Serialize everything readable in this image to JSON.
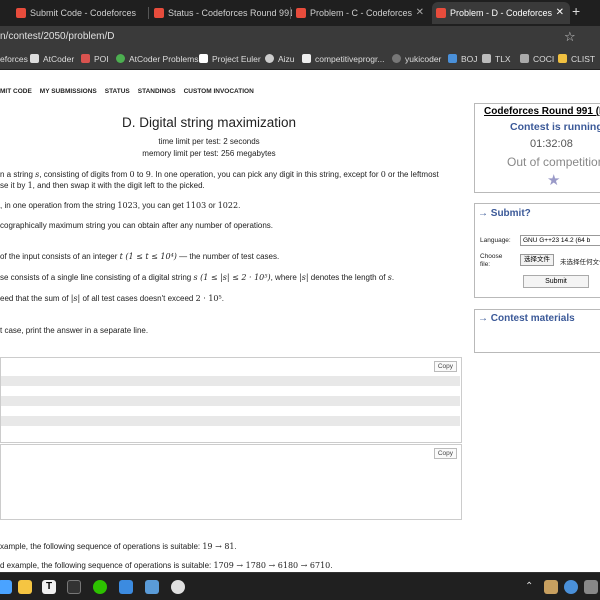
{
  "browser": {
    "tabs": [
      {
        "title": "Submit Code - Codeforces",
        "active": false
      },
      {
        "title": "Status - Codeforces Round 991",
        "active": false
      },
      {
        "title": "Problem - C - Codeforces",
        "active": false
      },
      {
        "title": "Problem - D - Codeforces",
        "active": true
      }
    ],
    "new_tab_label": "+",
    "address": "n/contest/2050/problem/D",
    "bookmarks": [
      "eforces",
      "AtCoder",
      "POI",
      "AtCoder Problems",
      "Project Euler",
      "Aizu",
      "competitiveprogr...",
      "yukicoder",
      "BOJ",
      "TLX",
      "COCI",
      "CLIST"
    ]
  },
  "nav": [
    "MIT CODE",
    "MY SUBMISSIONS",
    "STATUS",
    "STANDINGS",
    "CUSTOM INVOCATION"
  ],
  "problem": {
    "title": "D. Digital string maximization",
    "time_limit": "time limit per test: 2 seconds",
    "memory_limit": "memory limit per test: 256 megabytes",
    "statement_1a": "n a string ",
    "statement_1b": "s",
    "statement_1c": ", consisting of digits from ",
    "statement_1d": "0",
    "statement_1e": " to ",
    "statement_1f": "9",
    "statement_1g": ". In one operation, you can pick any digit in this string, except for ",
    "statement_1h": "0",
    "statement_1i": " or the leftmost",
    "statement_2a": "se it by ",
    "statement_2b": "1",
    "statement_2c": ", and then swap it with the digit left to the picked.",
    "statement_3a": ", in one operation from the string ",
    "statement_3b": "1023",
    "statement_3c": ", you can get ",
    "statement_3d": "1103",
    "statement_3e": " or ",
    "statement_3f": "1022",
    "statement_3g": ".",
    "statement_4": "cographically maximum string you can obtain after any number of operations.",
    "input_1a": " of the input consists of an integer ",
    "input_1b": "t (1 ≤ t ≤ 10⁴)",
    "input_1c": " — the number of test cases.",
    "input_2a": "se consists of a single line consisting of a digital string ",
    "input_2b": "s (1 ≤ |s| ≤ 2 · 10⁵)",
    "input_2c": ", where ",
    "input_2d": "|s|",
    "input_2e": " denotes the length of ",
    "input_2f": "s",
    "input_2g": ".",
    "input_3a": "eed that the sum of ",
    "input_3b": "|s|",
    "input_3c": " of all test cases doesn't exceed ",
    "input_3d": "2 · 10⁵",
    "input_3e": ".",
    "output_1": "t case, print the answer in a separate line.",
    "copy_label": "Copy",
    "note_1a": "xample, the following sequence of operations is suitable: ",
    "note_1b": "19 → 81",
    "note_1c": ".",
    "note_2a": "d example, the following sequence of operations is suitable: ",
    "note_2b": "1709 → 1780 → 6180 → 6710",
    "note_2c": "."
  },
  "sidebar": {
    "contest_title": "Codeforces Round 991 (D",
    "status": "Contest is running",
    "timer": "01:32:08",
    "participation": "Out of competition",
    "submit_header": "→ Submit?",
    "language_label": "Language:",
    "language_value": "GNU G++23 14.2 (64 b",
    "file_label_1": "Choose",
    "file_label_2": "file:",
    "choose_button": "选择文件",
    "no_file": "未选择任何文件",
    "submit_button": "Submit",
    "materials_header": "→ Contest materials"
  }
}
